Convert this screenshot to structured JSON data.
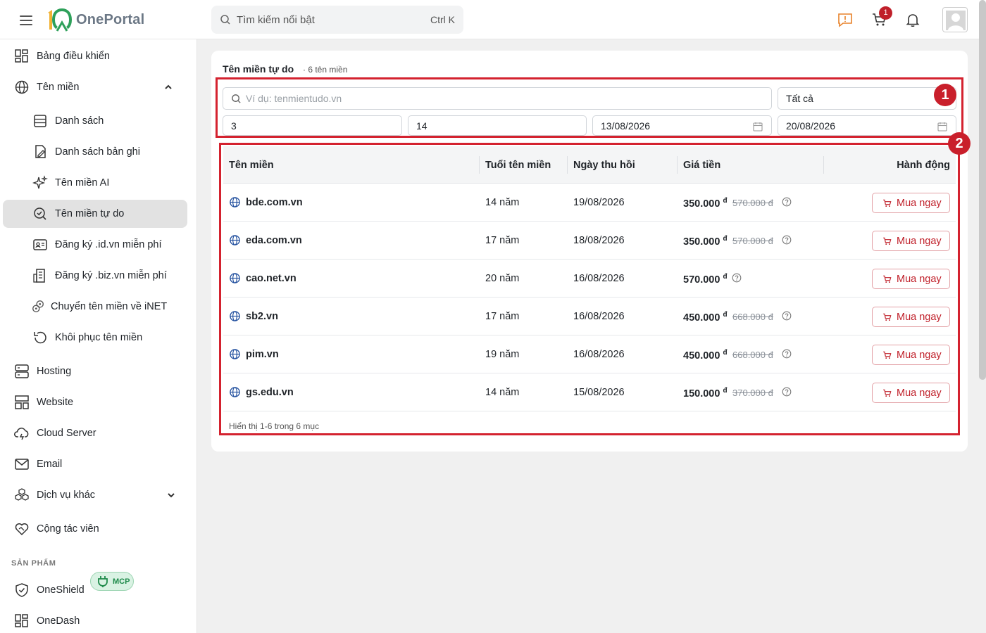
{
  "header": {
    "app_name": "OnePortal",
    "search_placeholder": "Tìm kiếm nổi bật",
    "search_shortcut": "Ctrl K",
    "cart_count": "1"
  },
  "sidebar": {
    "items": [
      {
        "label": "Bảng điều khiển"
      },
      {
        "label": "Tên miền"
      },
      {
        "label": "Danh sách"
      },
      {
        "label": "Danh sách bản ghi"
      },
      {
        "label": "Tên miền AI"
      },
      {
        "label": "Tên miền tự do"
      },
      {
        "label": "Đăng ký .id.vn miễn phí"
      },
      {
        "label": "Đăng ký .biz.vn miễn phí"
      },
      {
        "label": "Chuyển tên miền về iNET"
      },
      {
        "label": "Khôi phục tên miền"
      },
      {
        "label": "Hosting"
      },
      {
        "label": "Website"
      },
      {
        "label": "Cloud Server"
      },
      {
        "label": "Email"
      },
      {
        "label": "Dịch vụ khác"
      },
      {
        "label": "Cộng tác viên"
      }
    ],
    "section_products": "SẢN PHẨM",
    "products": [
      {
        "label": "OneShield"
      },
      {
        "label": "OneDash",
        "badge": "MCP"
      }
    ]
  },
  "main": {
    "title": "Tên miền tự do",
    "subtitle": "· 6 tên miền",
    "filters": {
      "search_placeholder": "Ví dụ: tenmientudo.vn",
      "type_select": "Tất cả",
      "min_value": "3",
      "max_value": "14",
      "date_from": "13/08/2026",
      "date_to": "20/08/2026"
    },
    "annotations": [
      "1",
      "2"
    ],
    "table": {
      "columns": [
        "Tên miền",
        "Tuổi tên miền",
        "Ngày thu hồi",
        "Giá tiền",
        "Hành động"
      ],
      "rows": [
        {
          "domain": "bde.com.vn",
          "age": "14 năm",
          "date": "19/08/2026",
          "price": "350.000",
          "old_price": "570.000 đ",
          "action": "Mua ngay"
        },
        {
          "domain": "eda.com.vn",
          "age": "17 năm",
          "date": "18/08/2026",
          "price": "350.000",
          "old_price": "570.000 đ",
          "action": "Mua ngay"
        },
        {
          "domain": "cao.net.vn",
          "age": "20 năm",
          "date": "16/08/2026",
          "price": "570.000",
          "old_price": "",
          "action": "Mua ngay"
        },
        {
          "domain": "sb2.vn",
          "age": "17 năm",
          "date": "16/08/2026",
          "price": "450.000",
          "old_price": "668.000 đ",
          "action": "Mua ngay"
        },
        {
          "domain": "pim.vn",
          "age": "19 năm",
          "date": "16/08/2026",
          "price": "450.000",
          "old_price": "668.000 đ",
          "action": "Mua ngay"
        },
        {
          "domain": "gs.edu.vn",
          "age": "14 năm",
          "date": "15/08/2026",
          "price": "150.000",
          "old_price": "370.000 đ",
          "action": "Mua ngay"
        }
      ],
      "currency_symbol": "đ",
      "footer": "Hiển thị 1-6 trong 6 mục"
    }
  },
  "colors": {
    "accent": "#c0202a",
    "price": "#1c4b9c",
    "annotation": "#d4222f"
  }
}
